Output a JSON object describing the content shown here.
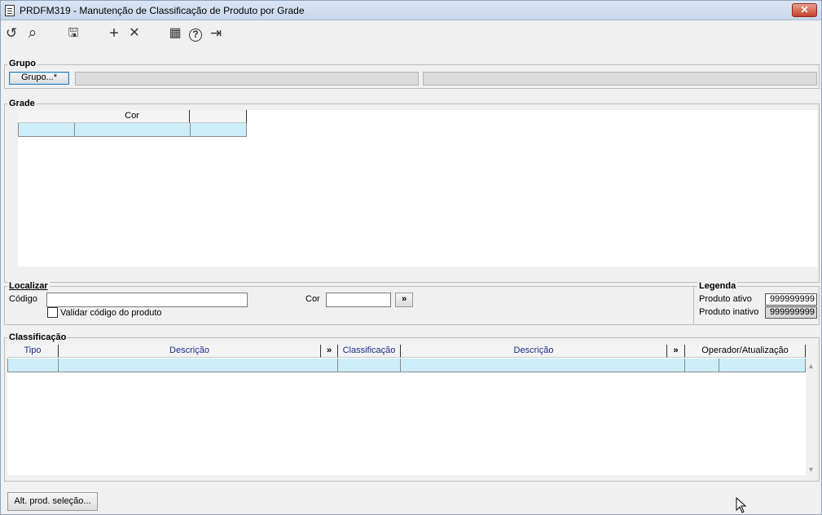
{
  "window": {
    "title": "PRDFM319 - Manutenção de Classificação de Produto por Grade",
    "close_glyph": "✕"
  },
  "toolbar": {
    "icons": [
      "undo-icon",
      "search-icon",
      "save-icon",
      "plus-icon",
      "delete-icon",
      "calendar-icon",
      "help-icon",
      "exit-icon"
    ],
    "glyphs": {
      "undo": "↺",
      "search": "⌕",
      "save": "🖫",
      "plus": "+",
      "delete": "✕",
      "calendar": "▦",
      "help": "?",
      "exit": "⇥"
    }
  },
  "grupo": {
    "label": "Grupo",
    "button_label": "Grupo...*",
    "field1_value": "",
    "field2_value": ""
  },
  "grade": {
    "label": "Grade",
    "columns": [
      "",
      "Cor",
      ""
    ]
  },
  "localizar": {
    "label": "Localizar",
    "codigo_label": "Código",
    "codigo_value": "",
    "cor_label": "Cor",
    "cor_value": "",
    "go_button": "»",
    "validar_label": "Validar código do produto",
    "validar_checked": false
  },
  "legenda": {
    "label": "Legenda",
    "ativo_label": "Produto ativo",
    "ativo_value": "999999999",
    "inativo_label": "Produto inativo",
    "inativo_value": "999999999"
  },
  "classificacao": {
    "label": "Classificação",
    "columns": {
      "tipo": "Tipo",
      "descricao1": "Descrição",
      "expand1": "»",
      "classificacao": "Classificação",
      "descricao2": "Descrição",
      "expand2": "»",
      "operador": "Operador/Atualização"
    }
  },
  "footer": {
    "alt_button": "Alt. prod. seleção..."
  },
  "colors": {
    "row_highlight": "#cdeef8",
    "header_text_blue": "#1a2a8a",
    "close_red": "#c7412a"
  }
}
